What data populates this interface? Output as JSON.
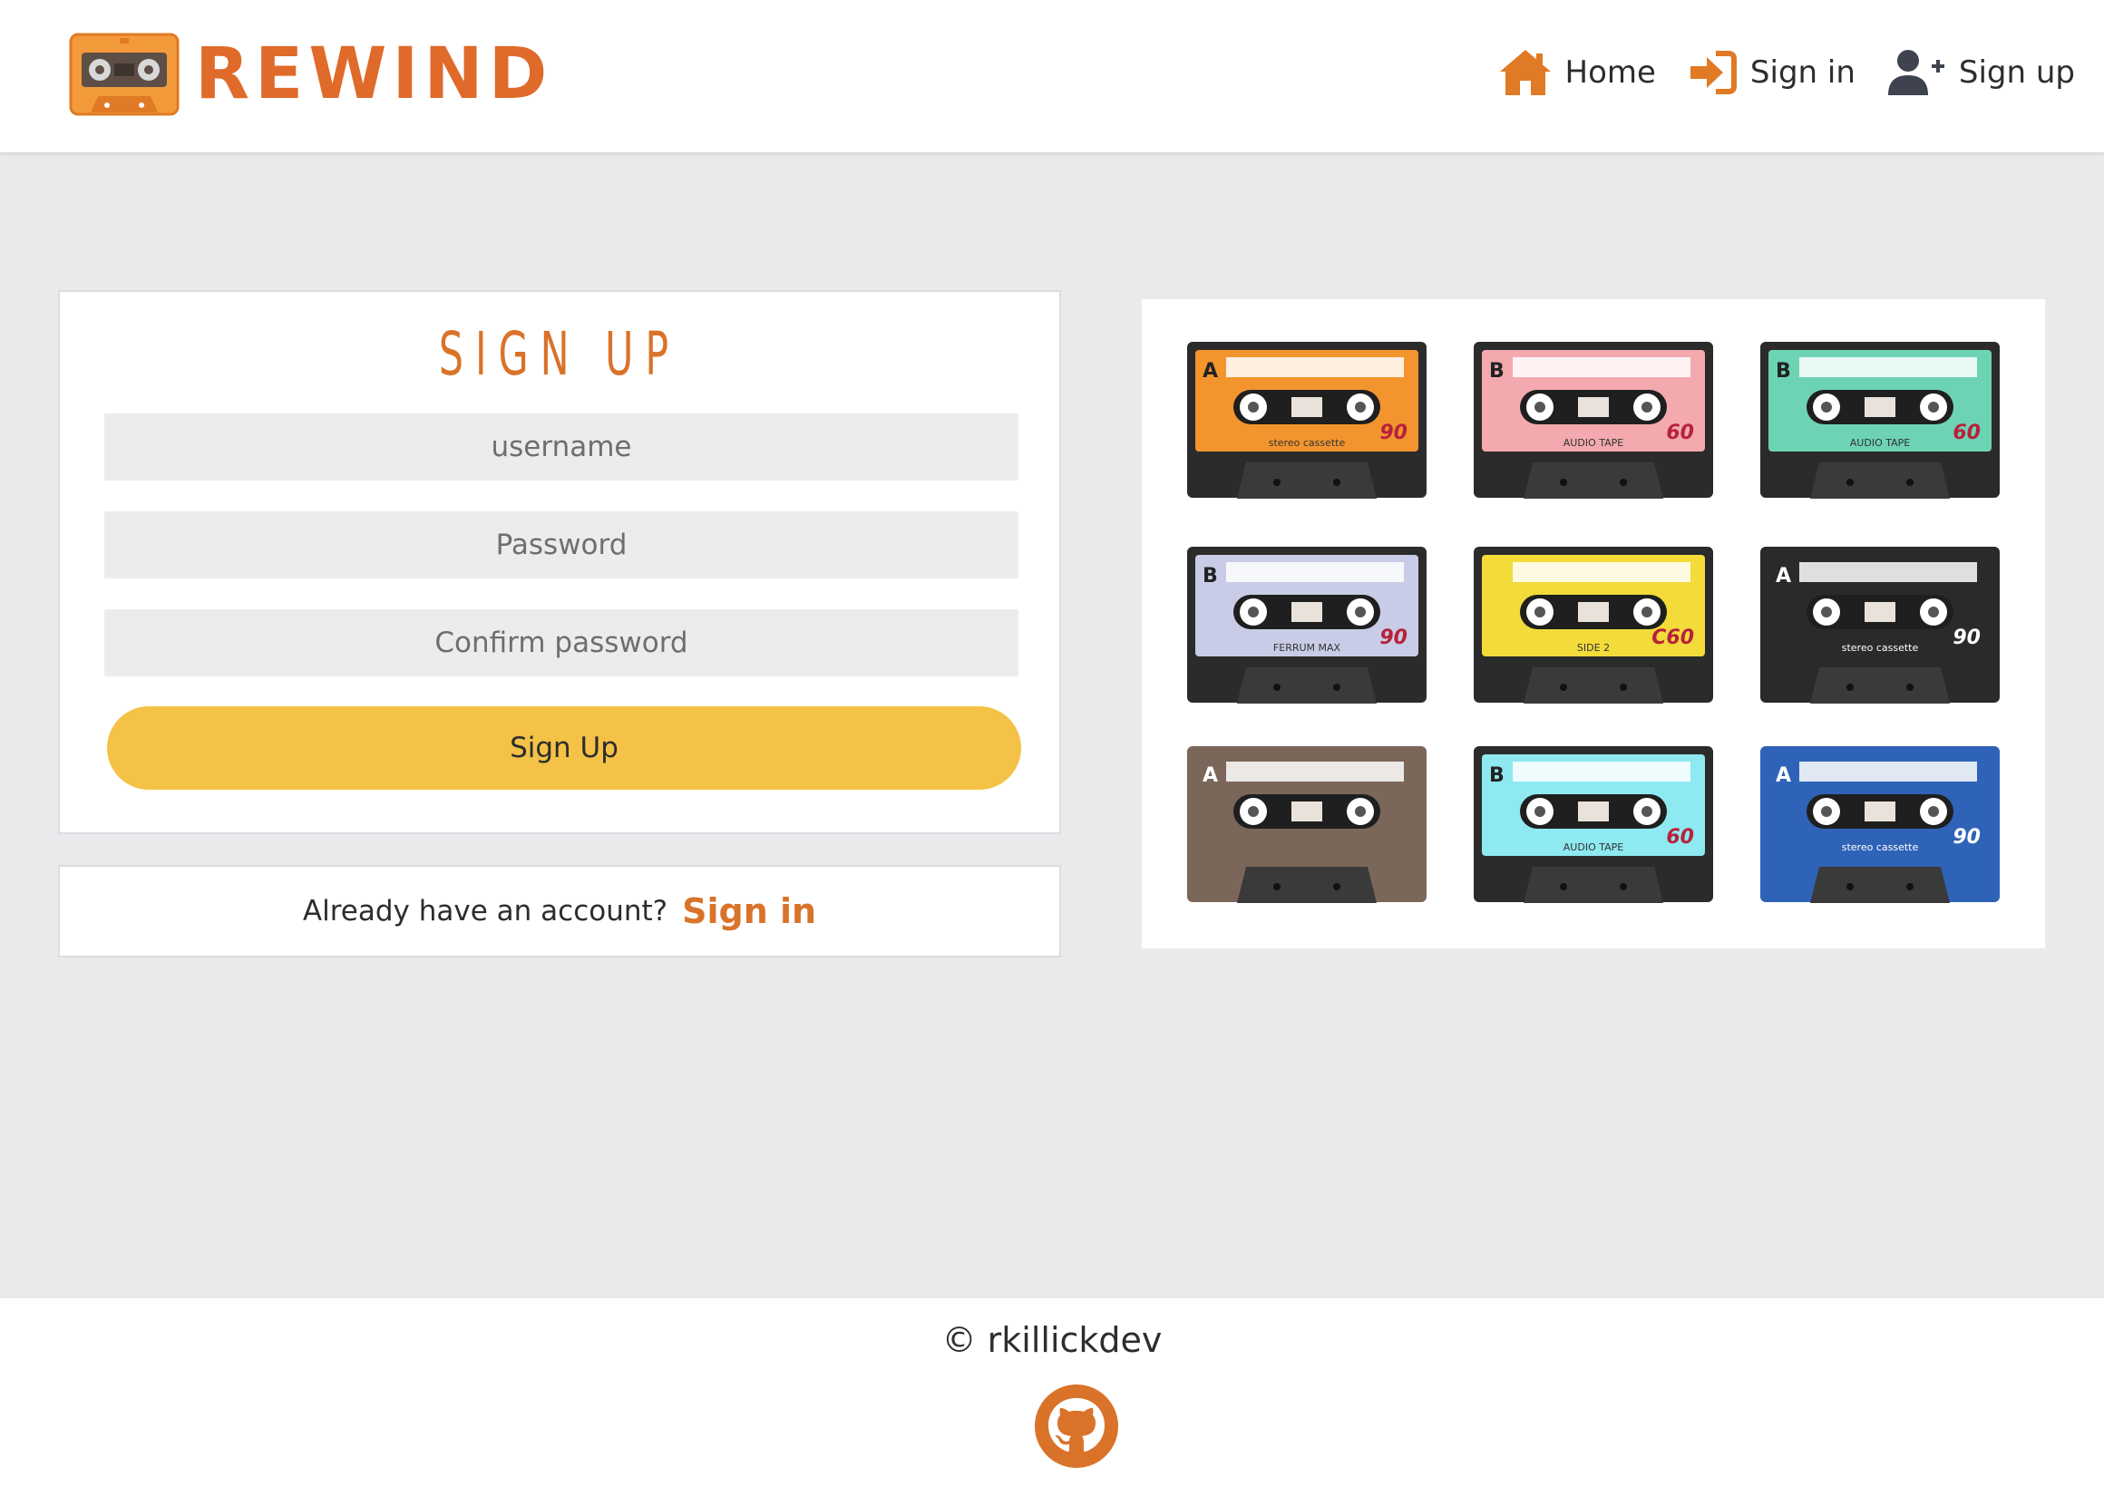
{
  "header": {
    "brand": "REWIND",
    "nav": [
      {
        "label": "Home",
        "icon": "home-icon"
      },
      {
        "label": "Sign in",
        "icon": "sign-in-icon"
      },
      {
        "label": "Sign up",
        "icon": "user-plus-icon"
      }
    ]
  },
  "signup": {
    "title": "SIGN UP",
    "username_placeholder": "username",
    "password_placeholder": "Password",
    "confirm_placeholder": "Confirm password",
    "button_label": "Sign Up"
  },
  "signin_prompt": {
    "text": "Already have an account?",
    "link": "Sign in"
  },
  "gallery": {
    "tapes": [
      {
        "side": "A",
        "number": "90",
        "caption": "stereo cassette",
        "color": "#f3952f"
      },
      {
        "side": "B",
        "number": "60",
        "caption": "AUDIO TAPE",
        "color": "#f3a9ae"
      },
      {
        "side": "B",
        "number": "60",
        "caption": "AUDIO TAPE",
        "color": "#6dd3b4"
      },
      {
        "side": "B",
        "number": "90",
        "caption": "FERRUM MAX",
        "color": "#c9cce6"
      },
      {
        "side": "",
        "number": "C60",
        "caption": "SIDE 2",
        "color": "#f3db3a"
      },
      {
        "side": "A",
        "number": "90",
        "caption": "stereo cassette",
        "color": "#2a2a2a"
      },
      {
        "side": "A",
        "number": "",
        "caption": "",
        "color": "#7b665a"
      },
      {
        "side": "B",
        "number": "60",
        "caption": "AUDIO TAPE",
        "color": "#8ee9f0"
      },
      {
        "side": "A",
        "number": "90",
        "caption": "stereo cassette",
        "color": "#2f63b7"
      }
    ]
  },
  "footer": {
    "copyright": "© rkillickdev",
    "icon": "github-icon"
  },
  "colors": {
    "accent": "#d9732a",
    "button": "#f3c246",
    "background": "#e9eaec"
  }
}
